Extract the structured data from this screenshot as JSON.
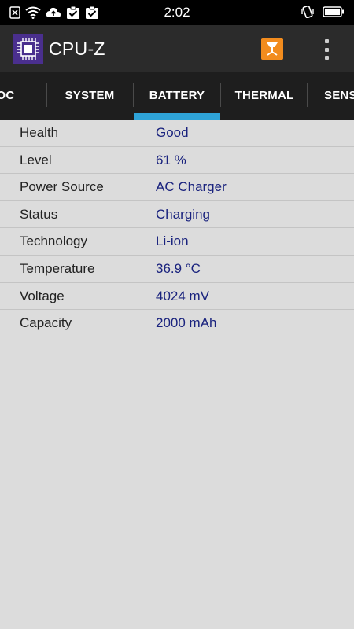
{
  "status_bar": {
    "time": "2:02",
    "left_icons": [
      "sim-off-icon",
      "wifi-icon",
      "cloud-upload-icon",
      "clipboard-check-icon",
      "clipboard-check-icon"
    ],
    "right_icons": [
      "vibrate-icon",
      "battery-icon"
    ]
  },
  "app_bar": {
    "title": "CPU-Z",
    "logo_icon": "cpu-chip-icon",
    "actions": [
      "validate-icon",
      "overflow-menu-icon"
    ],
    "colors": {
      "background": "#2b2b2b",
      "logo": "#4a2f8e",
      "validate": "#f28c1e"
    }
  },
  "tabs": [
    {
      "label": "OC"
    },
    {
      "label": "SYSTEM"
    },
    {
      "label": "BATTERY",
      "selected": true
    },
    {
      "label": "THERMAL"
    },
    {
      "label": "SENS"
    }
  ],
  "tab_indicator_color": "#2ea3d8",
  "battery": {
    "rows": [
      {
        "label": "Health",
        "value": "Good"
      },
      {
        "label": "Level",
        "value": "61 %"
      },
      {
        "label": "Power Source",
        "value": "AC Charger"
      },
      {
        "label": "Status",
        "value": "Charging"
      },
      {
        "label": "Technology",
        "value": "Li-ion"
      },
      {
        "label": "Temperature",
        "value": "36.9 °C"
      },
      {
        "label": "Voltage",
        "value": "4024 mV"
      },
      {
        "label": "Capacity",
        "value": "2000 mAh"
      }
    ]
  }
}
